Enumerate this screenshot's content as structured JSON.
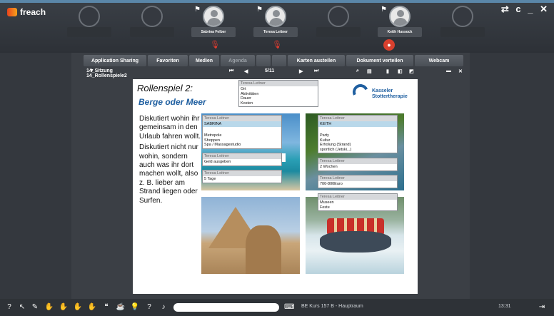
{
  "app": {
    "name": "freach",
    "window_controls": "⇄ c _ ✕"
  },
  "participants": [
    {
      "name": "",
      "active": false
    },
    {
      "name": "",
      "active": false
    },
    {
      "name": "Sabrina Felber",
      "active": true,
      "has_flag": true,
      "mic": "off"
    },
    {
      "name": "Teresa Leitner",
      "active": true,
      "has_flag": true,
      "mic": "off"
    },
    {
      "name": "",
      "active": false
    },
    {
      "name": "Keith Hussock",
      "active": true,
      "has_flag": true,
      "mic": "badge"
    },
    {
      "name": "",
      "active": false
    }
  ],
  "toolbar": {
    "tabs": [
      {
        "label": "Application Sharing",
        "enabled": true
      },
      {
        "label": "Favoriten",
        "enabled": true
      },
      {
        "label": "Medien",
        "enabled": true
      },
      {
        "label": "Agenda",
        "enabled": false
      },
      {
        "label": "",
        "enabled": false
      },
      {
        "label": "",
        "enabled": false
      },
      {
        "label": "Karten austeilen",
        "enabled": true
      },
      {
        "label": "Dokument verteilen",
        "enabled": true
      },
      {
        "label": "Webcam",
        "enabled": true
      }
    ]
  },
  "document": {
    "name": "14_Sitzung 14_Rollenspiele2",
    "page": "5/11"
  },
  "slide": {
    "title": "Rollenspiel 2:",
    "subtitle": "Berge oder Meer",
    "paragraphs": [
      "Diskutiert wohin ihr gemeinsam in den Urlaub fahren wollt.",
      "Diskutiert nicht nur wohin, sondern auch was ihr dort machen wollt, also z. B. lieber am Strand liegen oder Surfen."
    ],
    "logo": {
      "line1": "Kasseler",
      "line2": "Stottertherapie"
    }
  },
  "notes": [
    {
      "author": "Teresa Leitner",
      "lines": [
        "Ort",
        "Aktivitäten",
        "Dauer",
        "Kosten"
      ]
    },
    {
      "author": "Teresa Leitner",
      "selected": "SABRINA",
      "lines": [
        "Metropole",
        "Shoppen",
        "Spa / Massagestudio"
      ]
    },
    {
      "author": "Teresa Leitner",
      "lines": [
        "Geld ausgeben"
      ]
    },
    {
      "author": "Teresa Leitner",
      "lines": [
        "5 Tage"
      ]
    },
    {
      "author": "Teresa Leitner",
      "selected": "KEITH",
      "lines": [
        "Party",
        "Kultur",
        "Erholung (Strand)",
        "sportlich (Jetski...)"
      ]
    },
    {
      "author": "Teresa Leitner",
      "lines": [
        "2 Wochen"
      ]
    },
    {
      "author": "Teresa Leitner",
      "lines": [
        "700-800Euro"
      ]
    },
    {
      "author": "Teresa Leitner",
      "lines": [
        "Museen",
        "Feste"
      ]
    }
  ],
  "status": {
    "room": "BE Kurs 157 B - Hauptraum",
    "time": "13:31"
  }
}
